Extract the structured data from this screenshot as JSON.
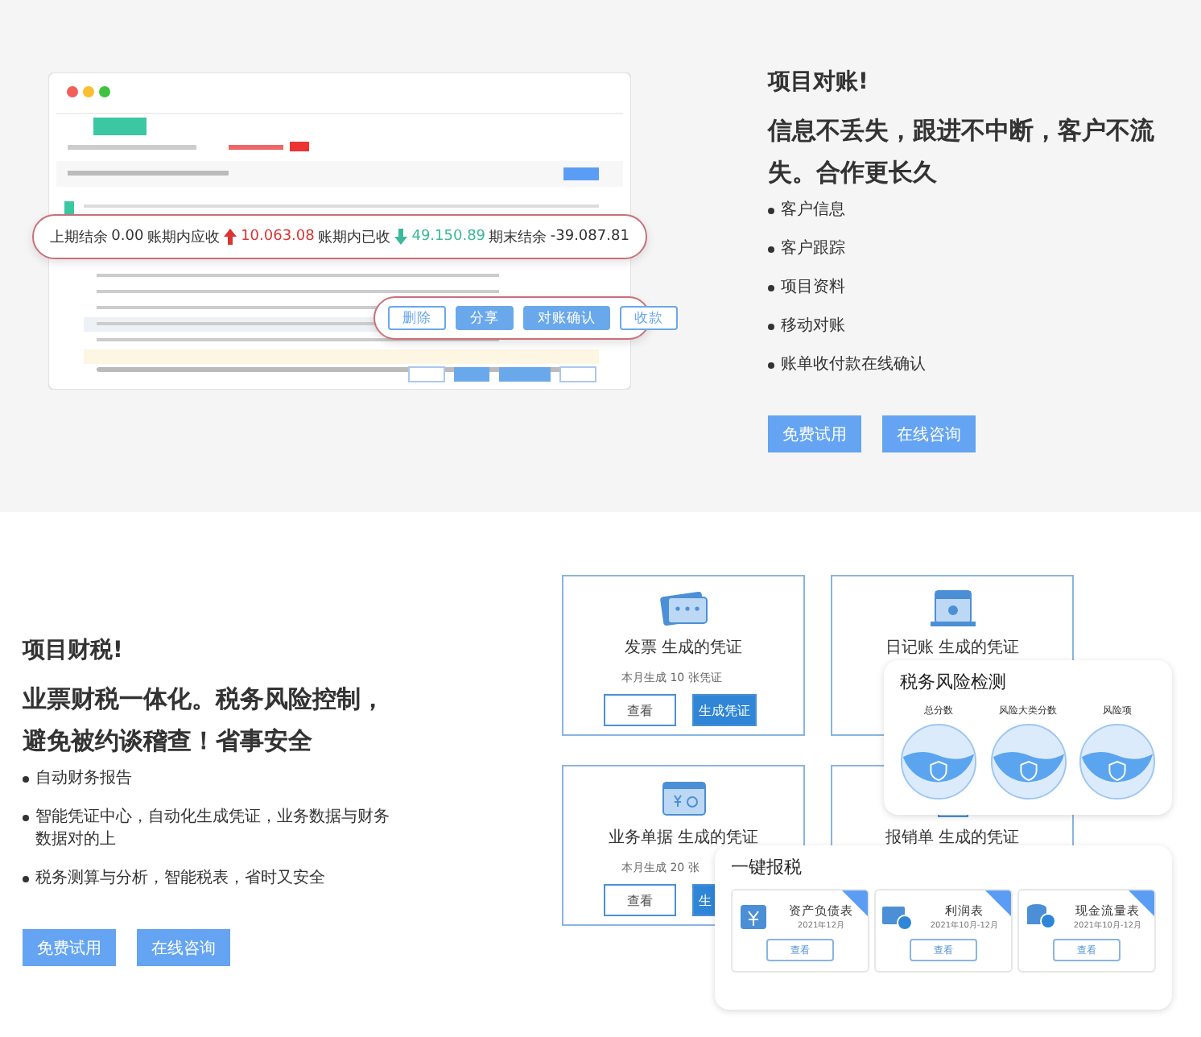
{
  "reconciliation": {
    "title": "项目对账!",
    "headline": "信息不丢失，跟进不中断，客户不流失。合作更长久",
    "bullets": [
      "客户信息",
      "客户跟踪",
      "项目资料",
      "移动对账",
      "账单收付款在线确认"
    ],
    "buttons": [
      "免费试用",
      "在线咨询"
    ],
    "summary": [
      {
        "label": "上期结余",
        "value": "0.00",
        "kind": "plain"
      },
      {
        "label": "账期内应收",
        "value": "10.063.08",
        "kind": "rise"
      },
      {
        "label": "账期内已收",
        "value": "49.150.89",
        "kind": "fall"
      },
      {
        "label": "期末结余",
        "value": "-39.087.81",
        "kind": "plain"
      }
    ],
    "actions": [
      {
        "label": "删除",
        "primary": false
      },
      {
        "label": "分享",
        "primary": true
      },
      {
        "label": "对账确认",
        "primary": true
      },
      {
        "label": "收款",
        "primary": false
      }
    ]
  },
  "tax": {
    "title": "项目财税!",
    "headline": "业票财税一体化。税务风险控制，避免被约谈稽查！省事安全",
    "bullets": [
      "自动财务报告",
      "智能凭证中心，自动化生成凭证，业务数据与财务数据对的上",
      "税务测算与分析，智能税表，省时又安全"
    ],
    "buttons": [
      "免费试用",
      "在线咨询"
    ],
    "voucher_cards": [
      {
        "kind": "invoice",
        "title": "发票 生成的凭证",
        "subtitle": "本月生成 10 张凭证",
        "buttons": [
          "查看",
          "生成凭证"
        ]
      },
      {
        "kind": "journal",
        "title": "日记账 生成的凭证"
      },
      {
        "kind": "bill",
        "title": "业务单据 生成的凭证",
        "subtitle": "本月生成 20 张",
        "buttons": [
          "查看",
          "生"
        ]
      },
      {
        "kind": "expense",
        "title": "报销单 生成的凭证"
      }
    ],
    "risk_panel": {
      "title": "税务风险检测",
      "gauges": [
        "总分数",
        "风险大类分数",
        "风险项"
      ]
    },
    "filing_panel": {
      "title": "一键报税",
      "reports": [
        {
          "kind": "balance",
          "name": "资产负债表",
          "period": "2021年12月",
          "button": "查看"
        },
        {
          "kind": "profit",
          "name": "利润表",
          "period": "2021年10月-12月",
          "button": "查看"
        },
        {
          "kind": "cash",
          "name": "现金流量表",
          "period": "2021年10月-12月",
          "button": "查看"
        }
      ]
    }
  }
}
